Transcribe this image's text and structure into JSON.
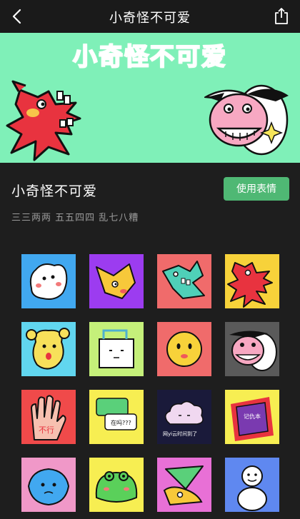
{
  "header": {
    "title": "小奇怪不可爱",
    "back_icon": "back-chevron-icon",
    "share_icon": "share-icon"
  },
  "banner": {
    "title": "小奇怪不可爱",
    "background": "#7ff0b8"
  },
  "pack": {
    "name": "小奇怪不可爱",
    "description": "三三两两 五五四四 乱七八糟",
    "use_button": "使用表情",
    "accent": "#4fb874"
  },
  "stickers": [
    {
      "bg": "#41a8f0",
      "icon": "white-ghost-monster"
    },
    {
      "bg": "#9c3cf0",
      "icon": "yellow-bird-monster"
    },
    {
      "bg": "#f06b6b",
      "icon": "teal-shark-monster"
    },
    {
      "bg": "#f7d23a",
      "icon": "red-dragon-monster"
    },
    {
      "bg": "#61d6ef",
      "icon": "yellow-pigtail-girl"
    },
    {
      "bg": "#c5f07a",
      "icon": "box-face"
    },
    {
      "bg": "#f06b6b",
      "icon": "yellow-smiley-face"
    },
    {
      "bg": "#5a5a5a",
      "icon": "pig-face-cow"
    },
    {
      "bg": "#f04a4a",
      "icon": "hand-no",
      "text": "不行"
    },
    {
      "bg": "#f7ee52",
      "icon": "chat-bubbles",
      "text": "在吗???"
    },
    {
      "bg": "#1a1a3a",
      "icon": "crying-cloud",
      "text": "网yi云时间到了"
    },
    {
      "bg": "#f7ee52",
      "icon": "purple-notebook",
      "text": "记仇本"
    },
    {
      "bg": "#f098c8",
      "icon": "blue-whale-monster"
    },
    {
      "bg": "#f7ee52",
      "icon": "green-frog-blob"
    },
    {
      "bg": "#e870d6",
      "icon": "green-triangle-bird"
    },
    {
      "bg": "#5f88f0",
      "icon": "snowman-figure"
    }
  ]
}
